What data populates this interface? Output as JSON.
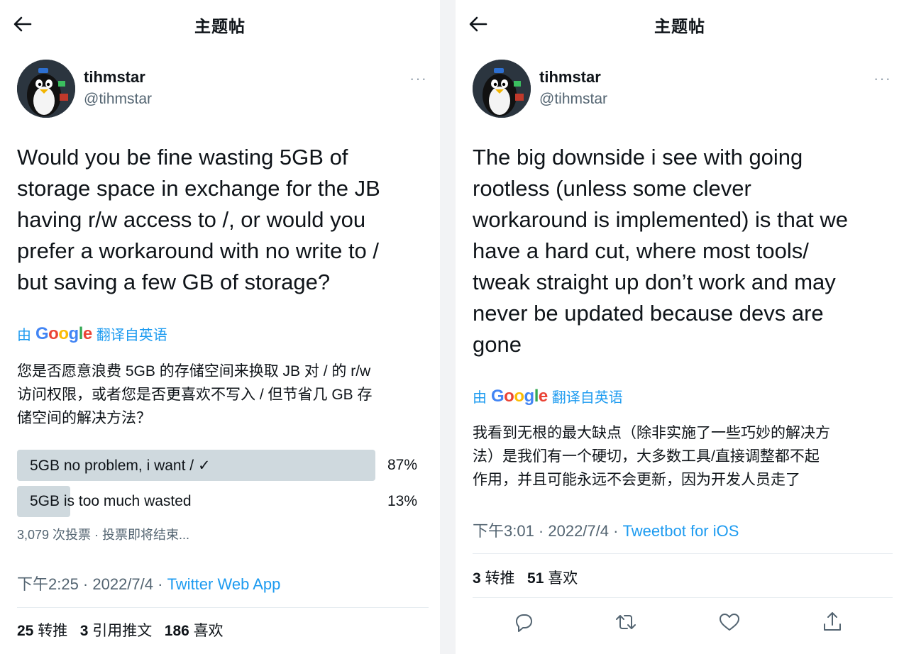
{
  "left": {
    "header": {
      "title": "主题帖"
    },
    "author": {
      "name": "tihmstar",
      "handle": "@tihmstar"
    },
    "tweet": {
      "lines": [
        "Would you be fine wasting 5GB of",
        "storage space in exchange for the JB",
        "having r/w access to /, or would you",
        "prefer a workaround with no write to /",
        "but saving a few GB of storage?"
      ]
    },
    "translate": {
      "by": "由",
      "google": "Google",
      "label": "翻译自英语"
    },
    "translated": [
      "您是否愿意浪费 5GB 的存储空间来换取 JB 对 / 的 r/w",
      "访问权限，或者您是否更喜欢不写入 / 但节省几 GB 存",
      "储空间的解决方法？"
    ],
    "poll": {
      "options": [
        {
          "label": "5GB no problem, i want / ✓",
          "percent": "87%",
          "fraction": 0.87
        },
        {
          "label": "5GB is too much wasted",
          "percent": "13%",
          "fraction": 0.13
        }
      ],
      "meta": "3,079 次投票 · 投票即将结束..."
    },
    "timestamp": {
      "time": "下午2:25 · 2022/7/4 · ",
      "source": "Twitter Web App"
    },
    "stats": {
      "retweets": "25",
      "retweets_label": "转推",
      "quotes": "3",
      "quotes_label": "引用推文",
      "likes": "186",
      "likes_label": "喜欢"
    }
  },
  "right": {
    "header": {
      "title": "主题帖"
    },
    "author": {
      "name": "tihmstar",
      "handle": "@tihmstar"
    },
    "tweet": {
      "lines": [
        "The big downside i see with going",
        "rootless (unless some clever",
        "workaround is implemented) is that we",
        "have a hard cut, where most tools/",
        "tweak straight up don’t work and may",
        "never be updated because devs are",
        "gone"
      ]
    },
    "translate": {
      "by": "由",
      "google": "Google",
      "label": "翻译自英语"
    },
    "translated": [
      "我看到无根的最大缺点（除非实施了一些巧妙的解决方",
      "法）是我们有一个硬切，大多数工具/直接调整都不起",
      "作用，并且可能永远不会更新，因为开发人员走了"
    ],
    "timestamp": {
      "time": "下午3:01 · 2022/7/4 · ",
      "source": "Tweetbot for iOS"
    },
    "stats": {
      "retweets": "3",
      "retweets_label": "转推",
      "likes": "51",
      "likes_label": "喜欢"
    }
  },
  "colors": {
    "link": "#1d9bf0",
    "secondary": "#536471",
    "poll_bar": "#cfd9de"
  },
  "icons": [
    "back-arrow-icon",
    "more-icon",
    "reply-icon",
    "retweet-icon",
    "like-icon",
    "share-icon"
  ]
}
